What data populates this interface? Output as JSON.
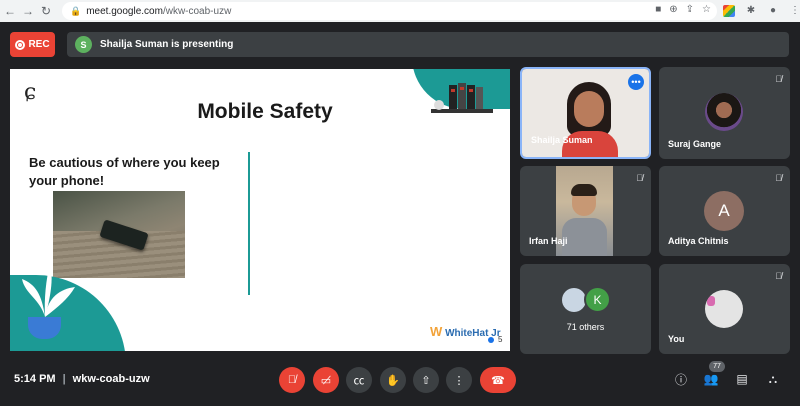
{
  "browser": {
    "url_host": "meet.google.com",
    "url_path": "/wkw-coab-uzw"
  },
  "topbar": {
    "rec_label": "REC",
    "presenter_initial": "S",
    "presenting_text": "Shailja Suman is presenting"
  },
  "slide": {
    "title": "Mobile Safety",
    "body": "Be cautious of where you keep your phone!",
    "brand": "WhiteHat Jr",
    "page_number": "5"
  },
  "participants": [
    {
      "name": "Shailja Suman"
    },
    {
      "name": "Suraj Gange"
    },
    {
      "name": "Irfan Haji"
    },
    {
      "name": "Aditya Chitnis",
      "initial": "A",
      "color": "#8d6e63"
    },
    {
      "name": "71 others",
      "initial": "K",
      "color": "#43a047"
    },
    {
      "name": "You"
    }
  ],
  "bottombar": {
    "time": "5:14 PM",
    "meeting_code": "wkw-coab-uzw",
    "people_count": "77"
  }
}
